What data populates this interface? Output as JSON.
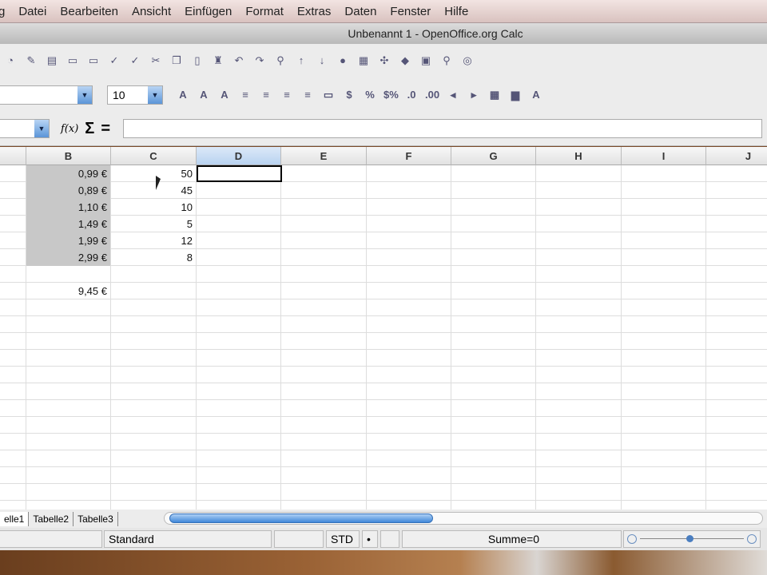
{
  "menu": [
    "g",
    "Datei",
    "Bearbeiten",
    "Ansicht",
    "Einfügen",
    "Format",
    "Extras",
    "Daten",
    "Fenster",
    "Hilfe"
  ],
  "title": "Unbenannt 1 - OpenOffice.org Calc",
  "toolbar2": {
    "font_name": "",
    "font_size": "10"
  },
  "formula_bar": {
    "name_box": "",
    "fx": "f(x)",
    "sum": "Σ",
    "equals": "=",
    "content": ""
  },
  "columns": [
    "B",
    "C",
    "D",
    "E",
    "F",
    "G",
    "H",
    "I",
    "J"
  ],
  "active_column": "D",
  "cells_b": [
    "0,99 €",
    "0,89 €",
    "1,10 €",
    "1,49 €",
    "1,99 €",
    "2,99 €",
    "",
    "9,45 €"
  ],
  "cells_c": [
    "50",
    "45",
    "10",
    "5",
    "12",
    "8"
  ],
  "sheet_tabs": [
    "elle1",
    "Tabelle2",
    "Tabelle3"
  ],
  "status": {
    "style": "Standard",
    "mode": "STD",
    "modified": "•",
    "sum": "Summe=0"
  }
}
